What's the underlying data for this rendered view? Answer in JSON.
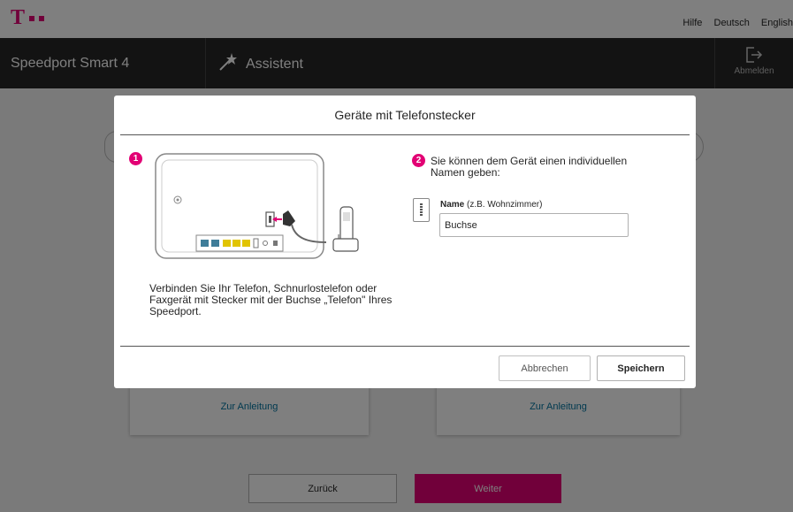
{
  "topbar": {
    "logo_text": "T",
    "links": [
      "Hilfe",
      "Deutsch",
      "English"
    ]
  },
  "header": {
    "product": "Speedport Smart 4",
    "assistant_label": "Assistent",
    "logout_label": "Abmelden"
  },
  "background": {
    "cards": [
      {
        "link": "Zur Anleitung"
      },
      {
        "link": "Zur Anleitung"
      }
    ],
    "back_label": "Zurück",
    "next_label": "Weiter"
  },
  "modal": {
    "title": "Geräte mit Telefonstecker",
    "step1_number": "1",
    "step1_text": "Verbinden Sie Ihr Telefon, Schnurlostelefon oder Faxgerät mit Stecker mit der Buchse „Telefon\" Ihres Speedport.",
    "step2_number": "2",
    "step2_text": "Sie können dem Gerät einen individuellen Namen geben:",
    "name_label": "Name",
    "name_hint": "(z.B. Wohnzimmer)",
    "name_value": "Buchse",
    "cancel_label": "Abbrechen",
    "save_label": "Speichern"
  },
  "colors": {
    "brand": "#e20074",
    "header_bg": "#262626",
    "link": "#00739f",
    "overlay": "rgba(0,0,0,0.5)"
  },
  "icons": [
    "wand-icon",
    "logout-icon",
    "router-illustration",
    "phone-icon",
    "field-info-icon"
  ]
}
